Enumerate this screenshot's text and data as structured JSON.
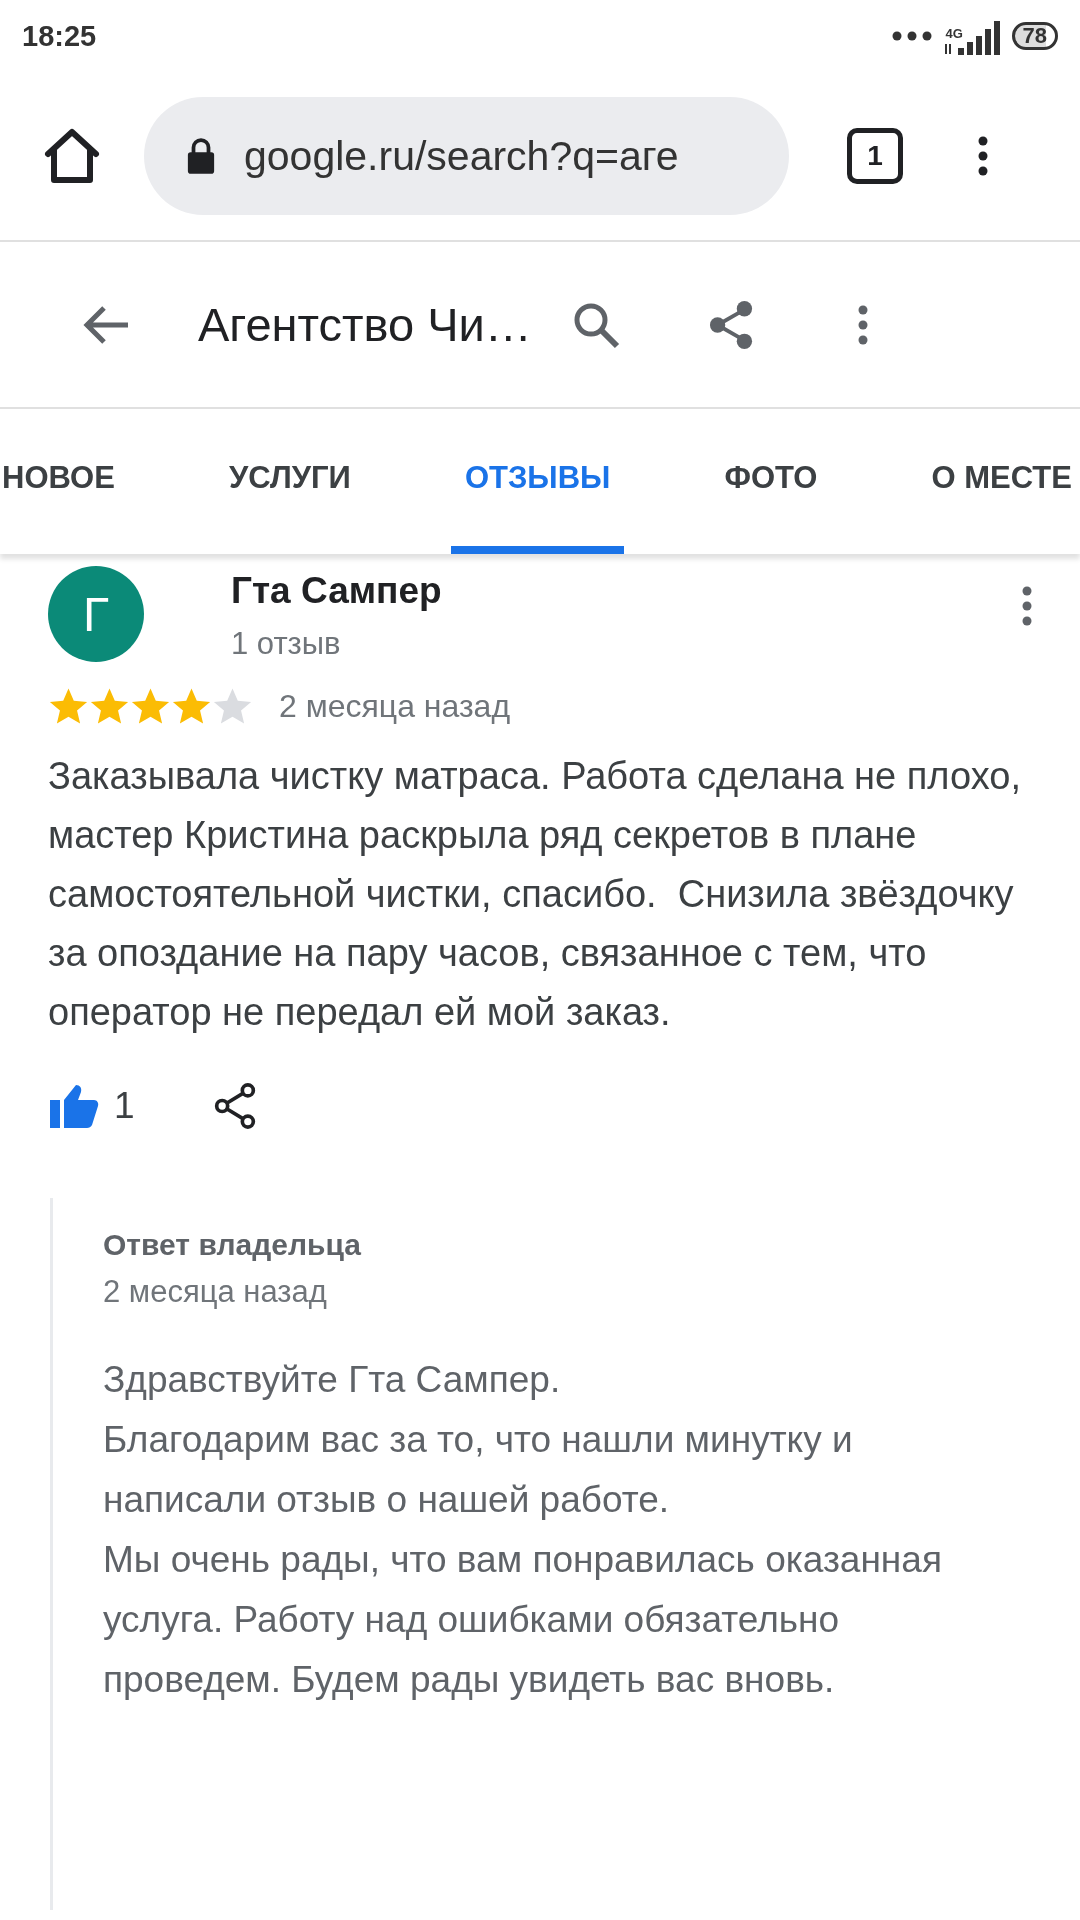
{
  "status_bar": {
    "time": "18:25",
    "network": "4G",
    "battery": "78"
  },
  "browser": {
    "url": "google.ru/search?q=аге",
    "tab_count": "1"
  },
  "place_header": {
    "title": "Агентство Чи…"
  },
  "tabs": [
    {
      "label": "НОВОЕ",
      "selected": false
    },
    {
      "label": "УСЛУГИ",
      "selected": false
    },
    {
      "label": "ОТЗЫВЫ",
      "selected": true
    },
    {
      "label": "ФОТО",
      "selected": false
    },
    {
      "label": "О МЕСТЕ",
      "selected": false
    }
  ],
  "review": {
    "avatar_letter": "Г",
    "author": "Гта Сампер",
    "review_count": "1 отзыв",
    "stars": 4,
    "time": "2 месяца назад",
    "text": "Заказывала чистку матраса. Работа сделана не плохо, мастер Кристина раскрыла ряд секретов в плане самостоятельной чистки, спасибо.  Снизила звёздочку за опоздание на пару часов, связанное с тем, что оператор не передал ей мой заказ.",
    "likes": "1"
  },
  "owner_reply": {
    "title": "Ответ владельца",
    "time": "2 месяца назад",
    "paragraphs": [
      "Здравствуйте Гта Сампер.",
      "Благодарим вас за то, что нашли минутку и написали отзыв о нашей работе.",
      "Мы очень рады, что вам понравилась оказанная услуга. Работу над ошибками обязательно проведем. Будем рады увидеть вас вновь."
    ]
  }
}
